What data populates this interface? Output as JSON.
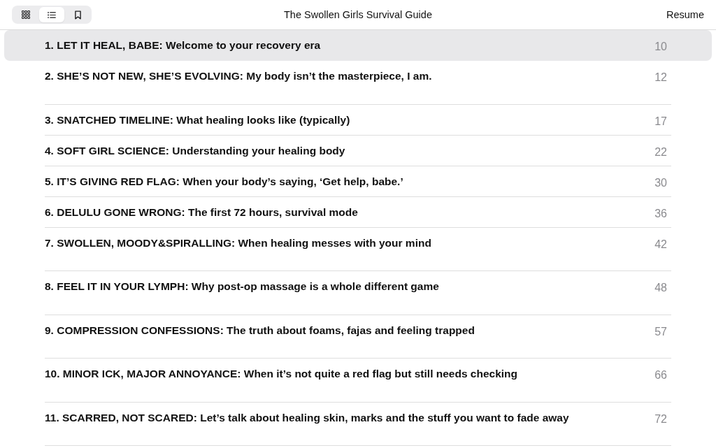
{
  "toolbar": {
    "view_tabs": [
      {
        "kind": "thumbnails",
        "selected": false
      },
      {
        "kind": "contents",
        "selected": true
      },
      {
        "kind": "bookmarks",
        "selected": false
      }
    ],
    "title": "The Swollen Girls Survival Guide",
    "resume_button": "Resume"
  },
  "chapters": [
    {
      "title": "1. LET IT HEAL, BABE: Welcome to your recovery era",
      "page": "10",
      "selected": true
    },
    {
      "title": "2. SHE’S NOT NEW, SHE’S EVOLVING: My body isn’t the masterpiece, I am.",
      "page": "12",
      "selected": false
    },
    {
      "title": "3. SNATCHED TIMELINE: What healing looks like (typically)",
      "page": "17",
      "selected": false
    },
    {
      "title": "4. SOFT GIRL SCIENCE: Understanding your healing body",
      "page": "22",
      "selected": false
    },
    {
      "title": "5. IT’S GIVING RED FLAG: When your body’s saying, ‘Get help, babe.’",
      "page": "30",
      "selected": false
    },
    {
      "title": "6. DELULU GONE WRONG: The first 72 hours, survival mode",
      "page": "36",
      "selected": false
    },
    {
      "title": "7. SWOLLEN, MOODY&SPIRALLING: When healing messes with your mind",
      "page": "42",
      "selected": false
    },
    {
      "title": "8. FEEL IT IN YOUR LYMPH: Why post-op massage is a whole different game",
      "page": "48",
      "selected": false
    },
    {
      "title": "9. COMPRESSION CONFESSIONS: The truth about foams, fajas and feeling trapped",
      "page": "57",
      "selected": false
    },
    {
      "title": "10. MINOR ICK, MAJOR ANNOYANCE: When it’s not quite a red flag but still needs checking",
      "page": "66",
      "selected": false
    },
    {
      "title": "11. SCARRED, NOT SCARED: Let’s talk about healing skin, marks and the stuff you want to fade away",
      "page": "72",
      "selected": false
    }
  ]
}
